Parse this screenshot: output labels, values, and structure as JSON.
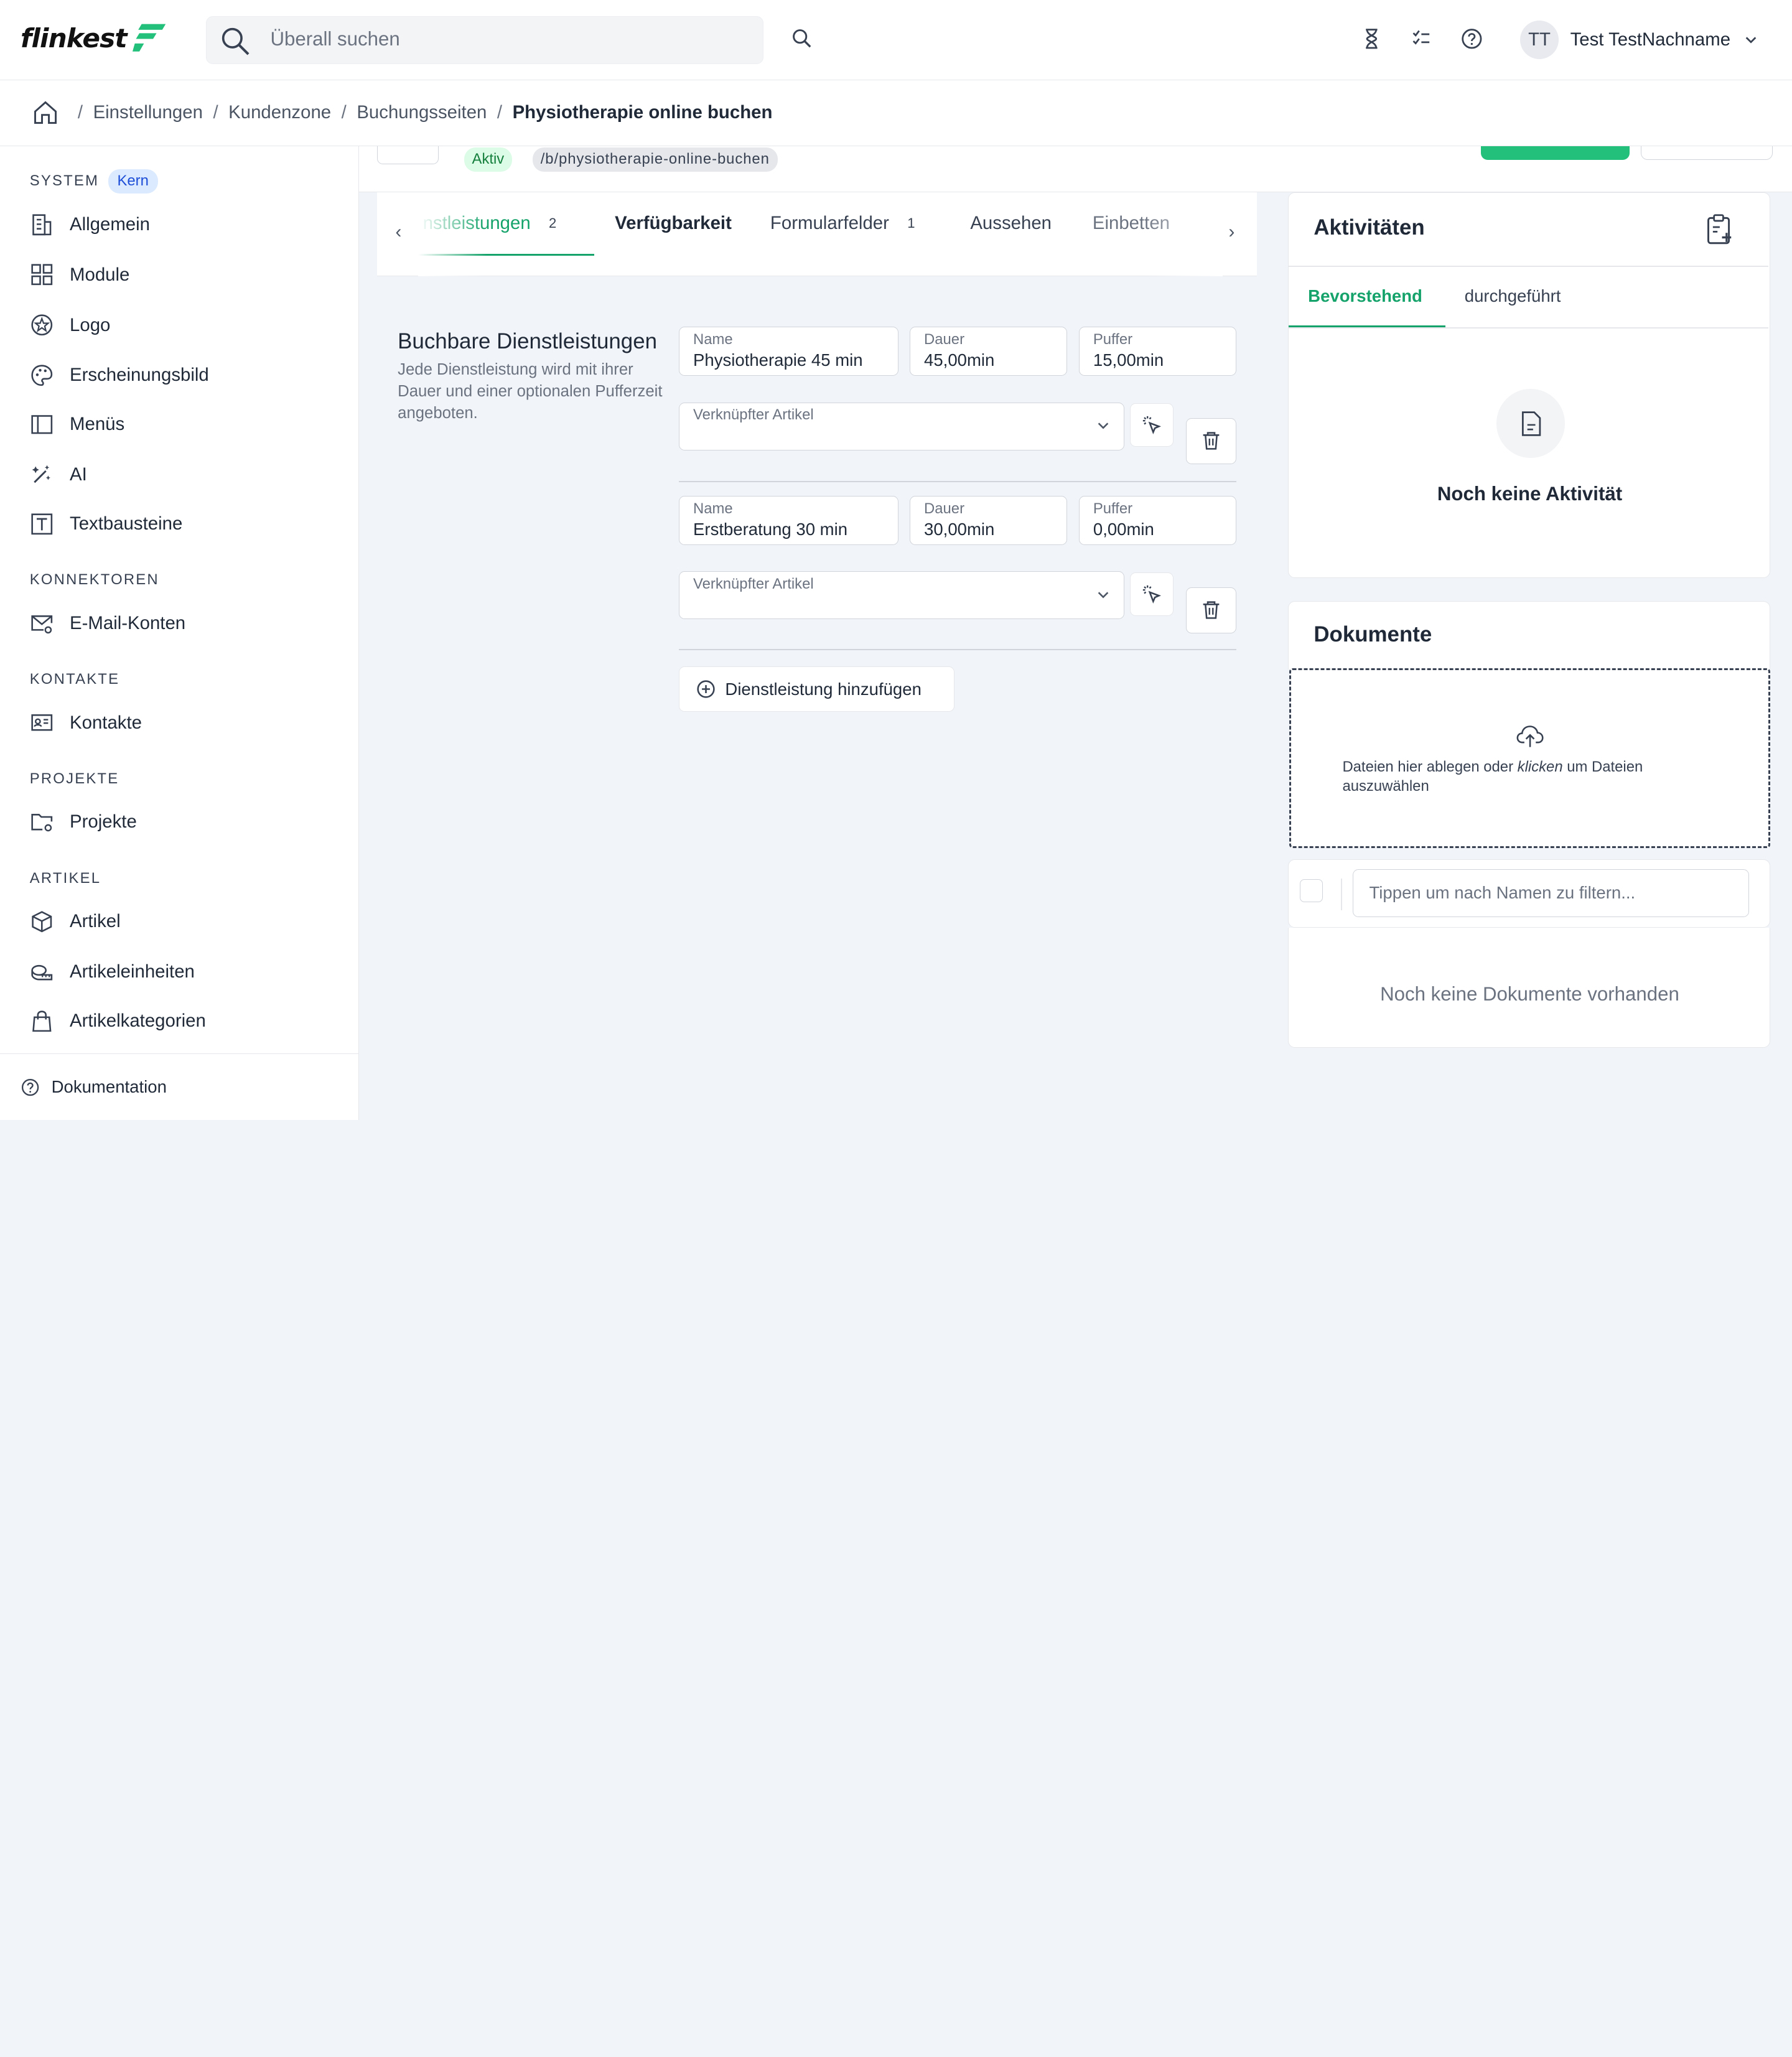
{
  "app": {
    "logo_text": "flinkest",
    "brand_color": "#22c07a"
  },
  "search": {
    "placeholder": "Überall suchen"
  },
  "user": {
    "initials": "TT",
    "name": "Test TestNachname"
  },
  "breadcrumb": {
    "items": [
      "Einstellungen",
      "Kundenzone",
      "Buchungsseiten"
    ],
    "current": "Physiotherapie online buchen"
  },
  "sidebar": {
    "system_label": "SYSTEM",
    "system_badge": "Kern",
    "system_items": [
      "Allgemein",
      "Module",
      "Logo",
      "Erscheinungsbild",
      "Menüs",
      "AI",
      "Textbausteine"
    ],
    "konnektoren_label": "KONNEKTOREN",
    "konnektoren_items": [
      "E-Mail-Konten"
    ],
    "kontakte_label": "KONTAKTE",
    "kontakte_items": [
      "Kontakte"
    ],
    "projekte_label": "PROJEKTE",
    "projekte_items": [
      "Projekte"
    ],
    "artikel_label": "ARTIKEL",
    "artikel_items": [
      "Artikel",
      "Artikeleinheiten",
      "Artikelkategorien"
    ],
    "documentation": "Dokumentation"
  },
  "page": {
    "status": "Aktiv",
    "slug": "/b/physiotherapie-online-buchen"
  },
  "tabs": [
    {
      "label": "nstleistungen",
      "count": "2"
    },
    {
      "label": "Verfügbarkeit",
      "count": ""
    },
    {
      "label": "Formularfelder",
      "count": "1"
    },
    {
      "label": "Aussehen",
      "count": ""
    },
    {
      "label": "Einbetten",
      "count": ""
    }
  ],
  "services": {
    "title": "Buchbare Dienstleistungen",
    "description": "Jede Dienstleistung wird mit ihrer Dauer und einer optionalen Pufferzeit angeboten.",
    "name_label": "Name",
    "duration_label": "Dauer",
    "buffer_label": "Puffer",
    "article_label": "Verknüpfter Artikel",
    "items": [
      {
        "name": "Physiotherapie 45 min",
        "duration": "45,00min",
        "buffer": "15,00min"
      },
      {
        "name": "Erstberatung 30 min",
        "duration": "30,00min",
        "buffer": "0,00min"
      }
    ],
    "add_label": "Dienstleistung hinzufügen"
  },
  "activities": {
    "title": "Aktivitäten",
    "tab_upcoming": "Bevorstehend",
    "tab_done": "durchgeführt",
    "empty": "Noch keine Aktivität"
  },
  "documents": {
    "title": "Dokumente",
    "drop_before": "Dateien hier ablegen oder ",
    "drop_em": "klicken",
    "drop_after": " um Dateien auszuwählen",
    "filter_placeholder": "Tippen um nach Namen zu filtern...",
    "empty": "Noch keine Dokumente vorhanden"
  }
}
